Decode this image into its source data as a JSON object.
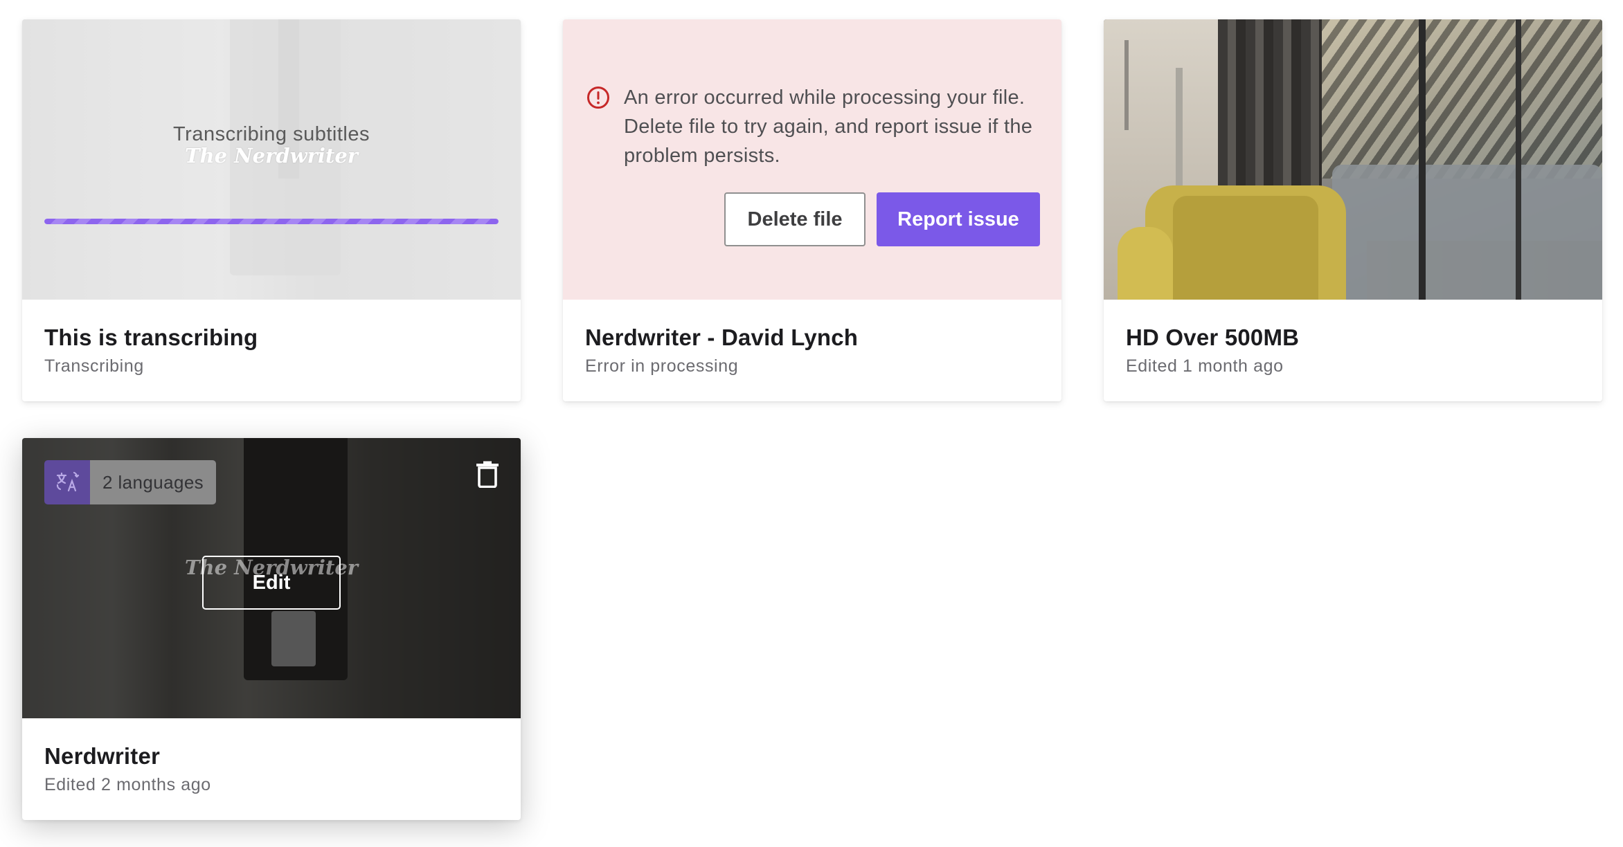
{
  "cards": [
    {
      "title": "This is transcribing",
      "status": "Transcribing",
      "overlay_label": "Transcribing subtitles",
      "thumbnail_logo": "The Nerdwriter",
      "progress_fraction": 1.0
    },
    {
      "title": "Nerdwriter - David Lynch",
      "status": "Error in processing",
      "error_message": "An error occurred while processing your file. Delete file to try again, and report issue if the problem persists.",
      "delete_label": "Delete file",
      "report_label": "Report issue"
    },
    {
      "title": "HD Over 500MB",
      "status": "Edited 1 month ago"
    },
    {
      "title": "Nerdwriter",
      "status": "Edited 2 months ago",
      "languages_label": "2 languages",
      "edit_label": "Edit",
      "thumbnail_logo": "The Nerdwriter"
    }
  ],
  "icons": {
    "error": "error-circle-icon",
    "translate": "translate-icon",
    "trash": "trash-icon"
  },
  "colors": {
    "accent": "#7b59e8",
    "error_bg": "#f8e5e6",
    "error_icon": "#c62828"
  }
}
